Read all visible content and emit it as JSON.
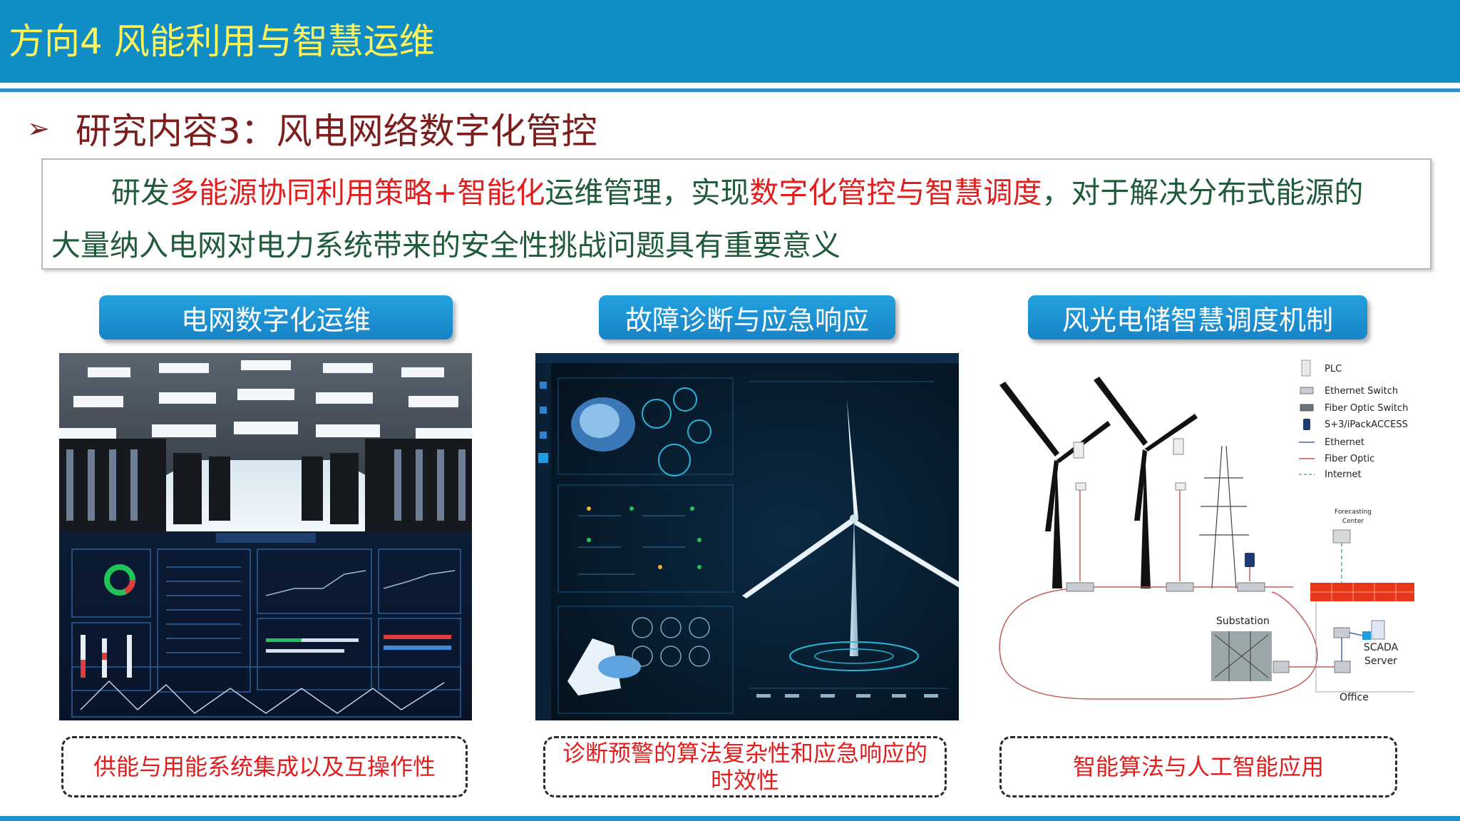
{
  "header": {
    "title": "方向4 风能利用与智慧运维"
  },
  "section": {
    "arrow": "➢",
    "title": "研究内容3：风电网络数字化管控"
  },
  "summary": {
    "l1_a": "研发",
    "l1_b": "多能源协同利用策略+智能化",
    "l1_c": "运维管理，实现",
    "l1_d": "数字化管控与智慧调度",
    "l1_e": "，对于解决分布式能源的",
    "l2": "大量纳入电网对电力系统带来的安全性挑战问题具有重要意义"
  },
  "panels": [
    {
      "label": "电网数字化运维",
      "caption": "供能与用能系统集成以及互操作性"
    },
    {
      "label": "故障诊断与应急响应",
      "caption_1": "诊断预警的算法复杂性和应急响应的",
      "caption_2": "时效性"
    },
    {
      "label": "风光电储智慧调度机制",
      "caption": "智能算法与人工智能应用"
    }
  ],
  "diagram": {
    "legend": [
      "PLC",
      "Ethernet Switch",
      "Fiber Optic Switch",
      "S+3/iPackACCESS",
      "Ethernet",
      "Fiber Optic",
      "Internet"
    ],
    "forecasting": [
      "Forecasting",
      "Center"
    ],
    "substation": "Substation",
    "scada": [
      "SCADA",
      "Server"
    ],
    "office": "Office"
  },
  "colors": {
    "title_bar": "#0f8dc4",
    "title_text": "#fff35a",
    "accent_red": "#e01e1e",
    "section_title": "#7b1e1e"
  }
}
